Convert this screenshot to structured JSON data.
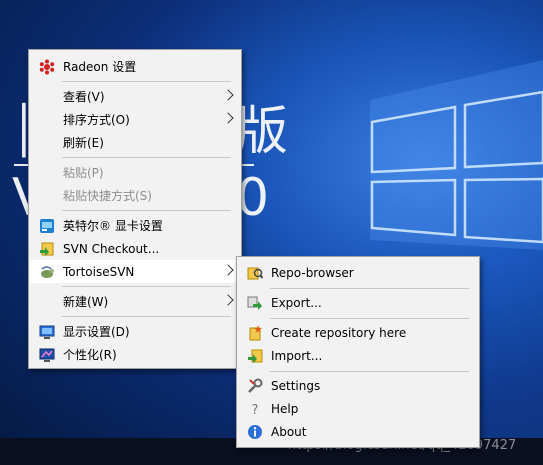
{
  "desktop": {
    "wallpaper_text_1": "版",
    "wallpaper_text_2": "V",
    "wallpaper_text_3": "0"
  },
  "context_menu": {
    "items": [
      {
        "label": "Radeon 设置",
        "icon": "radeon-icon"
      },
      {
        "label": "查看(V)",
        "submenu": true
      },
      {
        "label": "排序方式(O)",
        "submenu": true
      },
      {
        "label": "刷新(E)"
      },
      {
        "label": "粘贴(P)",
        "disabled": true
      },
      {
        "label": "粘贴快捷方式(S)",
        "disabled": true
      },
      {
        "label": "英特尔® 显卡设置",
        "icon": "intel-graphics-icon"
      },
      {
        "label": "SVN Checkout...",
        "icon": "svn-checkout-icon"
      },
      {
        "label": "TortoiseSVN",
        "icon": "tortoisesvn-icon",
        "submenu": true,
        "highlighted": true
      },
      {
        "label": "新建(W)",
        "submenu": true
      },
      {
        "label": "显示设置(D)",
        "icon": "display-settings-icon"
      },
      {
        "label": "个性化(R)",
        "icon": "personalize-icon"
      }
    ]
  },
  "submenu": {
    "items": [
      {
        "label": "Repo-browser",
        "icon": "repo-browser-icon"
      },
      {
        "label": "Export...",
        "icon": "export-icon"
      },
      {
        "label": "Create repository here",
        "icon": "create-repo-icon"
      },
      {
        "label": "Import...",
        "icon": "import-icon"
      },
      {
        "label": "Settings",
        "icon": "settings-icon"
      },
      {
        "label": "Help",
        "icon": "help-icon"
      },
      {
        "label": "About",
        "icon": "about-icon"
      }
    ]
  },
  "watermark": "https://blog.csdn.net/qq_42897427",
  "colors": {
    "menu_bg": "#f2f2f2",
    "separator": "#c8c8c8",
    "disabled_text": "#8f8f8f"
  }
}
